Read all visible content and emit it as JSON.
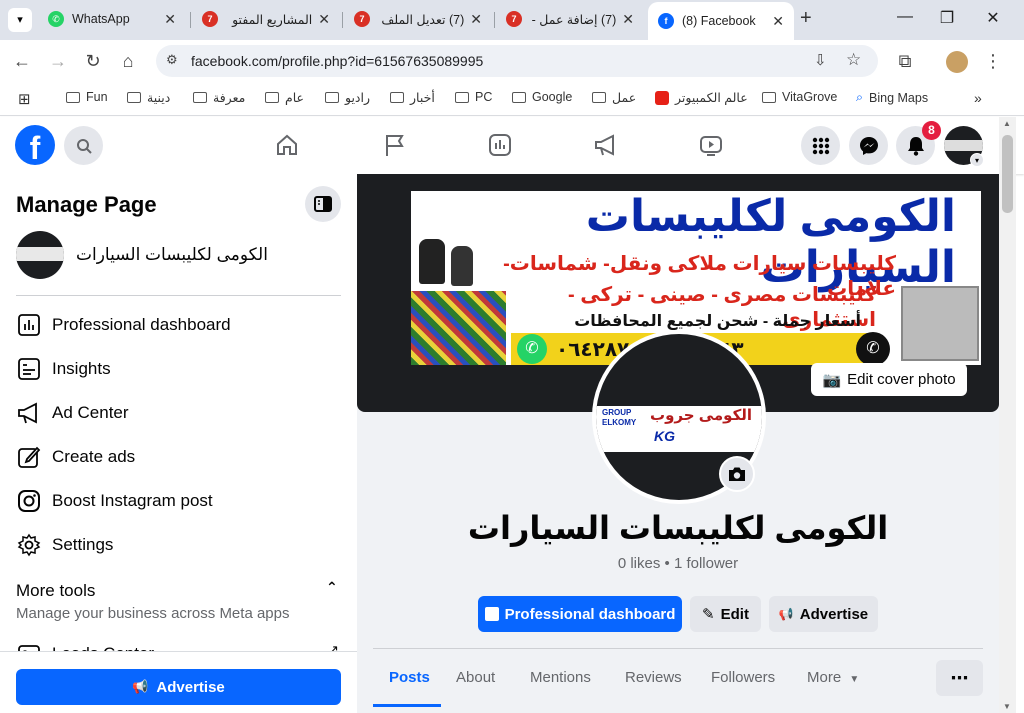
{
  "browser": {
    "tabs": [
      {
        "title": "WhatsApp"
      },
      {
        "title": "المشاريع المفتو"
      },
      {
        "title": "(7) تعديل الملف"
      },
      {
        "title": "(7) إضافة عمل -"
      },
      {
        "title": "(8) Facebook"
      }
    ],
    "url": "facebook.com/profile.php?id=61567635089995",
    "bookmarks": [
      "Fun",
      "دينية",
      "معرفة",
      "عام",
      "راديو",
      "أخبار",
      "PC",
      "Google",
      "عمل",
      "عالم الكمبيوتر",
      "VitaGrove",
      "Bing Maps"
    ]
  },
  "facebook": {
    "notification_count": "8",
    "left_panel": {
      "title": "Manage Page",
      "page_name": "الكومى لكليبسات السيارات",
      "items": [
        "Professional dashboard",
        "Insights",
        "Ad Center",
        "Create ads",
        "Boost Instagram post",
        "Settings"
      ],
      "more_tools_title": "More tools",
      "more_tools_sub": "Manage your business across Meta apps",
      "leads_center": "Leads Center",
      "advertise_button": "Advertise"
    },
    "cover": {
      "line1": "الكومى لكليبسات السيارات",
      "line2": "كليبسات سيارات ملاكى ونقل- شماسات- علامات",
      "line3": "كليبسات مصرى - صينى - تركى - استثمارى",
      "line4": "أسعار جملة - شحن لجميع المحافظات",
      "phone_partial": "٠١١١٤٣...٠٦٤٢٨٧٤٠",
      "edit_cover": "Edit cover photo"
    },
    "profile": {
      "logo_text_ar": "الكومى جروب",
      "logo_text_en1": "GROUP",
      "logo_text_en2": "ELKOMY",
      "logo_kg": "KG",
      "name": "الكومى لكليبسات السيارات",
      "stats": "0 likes • 1 follower"
    },
    "actions": {
      "dashboard": "Professional dashboard",
      "edit": "Edit",
      "advertise": "Advertise"
    },
    "profile_tabs": [
      "Posts",
      "About",
      "Mentions",
      "Reviews",
      "Followers",
      "More"
    ],
    "active_tab": "Posts"
  },
  "colors": {
    "fb_blue": "#0866ff",
    "cover_bg": "#1c1e21",
    "notif_red": "#e41e3f"
  }
}
